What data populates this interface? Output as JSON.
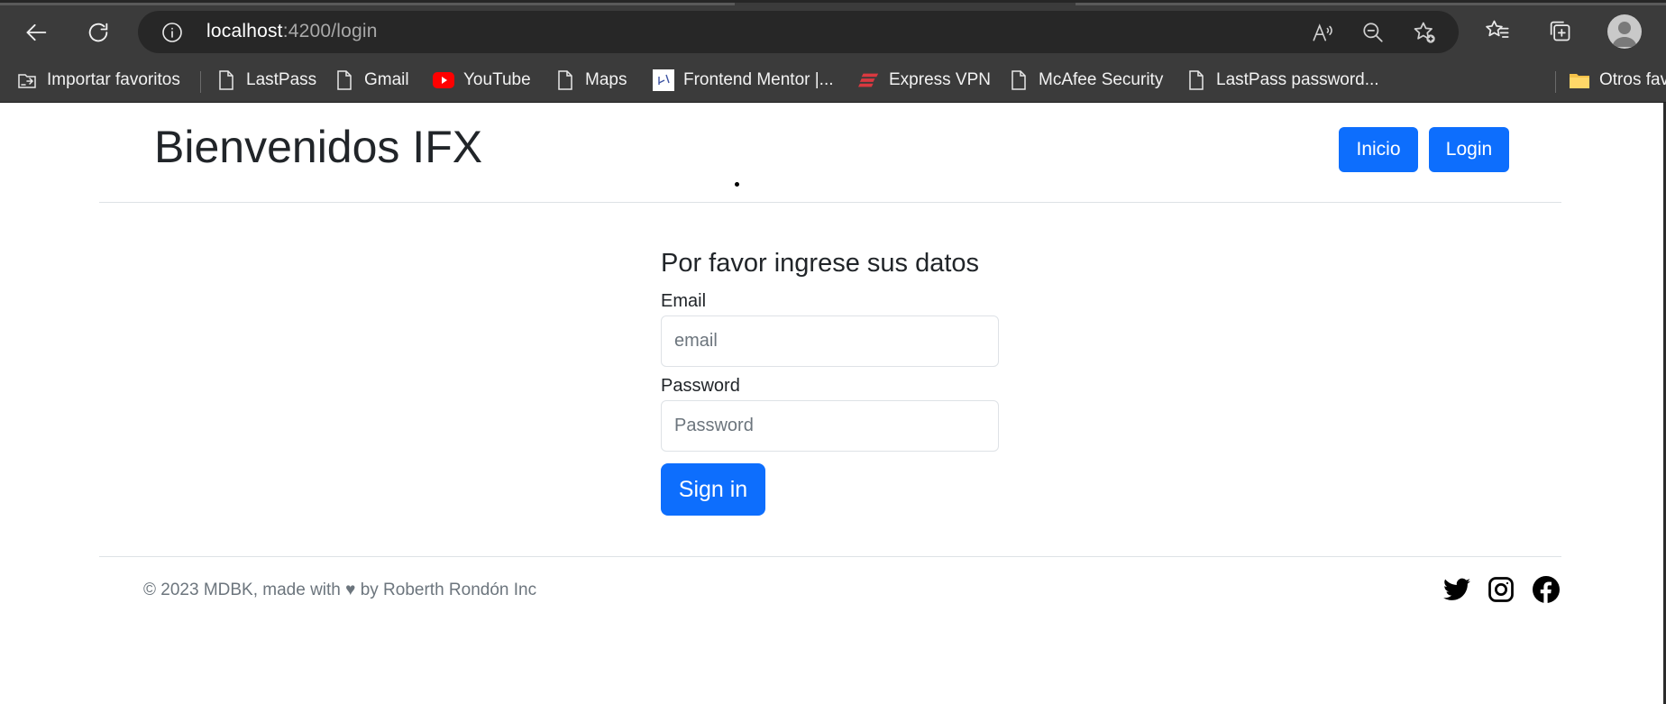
{
  "browser": {
    "url_host": "localhost",
    "url_path": ":4200/login",
    "icons": [
      "back-icon",
      "refresh-icon",
      "info-icon",
      "read-aloud-icon",
      "zoom-out-icon",
      "add-favorite-icon",
      "favorites-icon",
      "collections-icon",
      "profile-avatar"
    ]
  },
  "bookmarks": [
    {
      "label": "Importar favoritos",
      "icon": "import-favorites-icon"
    },
    {
      "label": "LastPass",
      "icon": "page-icon"
    },
    {
      "label": "Gmail",
      "icon": "page-icon"
    },
    {
      "label": "YouTube",
      "icon": "youtube-icon"
    },
    {
      "label": "Maps",
      "icon": "page-icon"
    },
    {
      "label": "Frontend Mentor |...",
      "icon": "frontend-mentor-icon"
    },
    {
      "label": "Express VPN",
      "icon": "expressvpn-icon"
    },
    {
      "label": "McAfee Security",
      "icon": "page-icon"
    },
    {
      "label": "LastPass password...",
      "icon": "page-icon"
    },
    {
      "label": "Otros fav",
      "icon": "folder-icon"
    }
  ],
  "header": {
    "brand": "Bienvenidos IFX",
    "nav": [
      {
        "label": "Inicio"
      },
      {
        "label": "Login"
      }
    ]
  },
  "login_form": {
    "title": "Por favor ingrese sus datos",
    "email_label": "Email",
    "email_placeholder": "email",
    "password_label": "Password",
    "password_placeholder": "Password",
    "submit_label": "Sign in"
  },
  "footer": {
    "text": "© 2023 MDBK, made with ♥ by Roberth Rondón Inc",
    "social": [
      "twitter-icon",
      "instagram-icon",
      "facebook-icon"
    ]
  },
  "colors": {
    "primary": "#0d6efd",
    "chrome_bg": "#3b3b3b",
    "omnibox_bg": "#272727",
    "text_dark": "#212529",
    "text_muted": "#6c757d"
  }
}
